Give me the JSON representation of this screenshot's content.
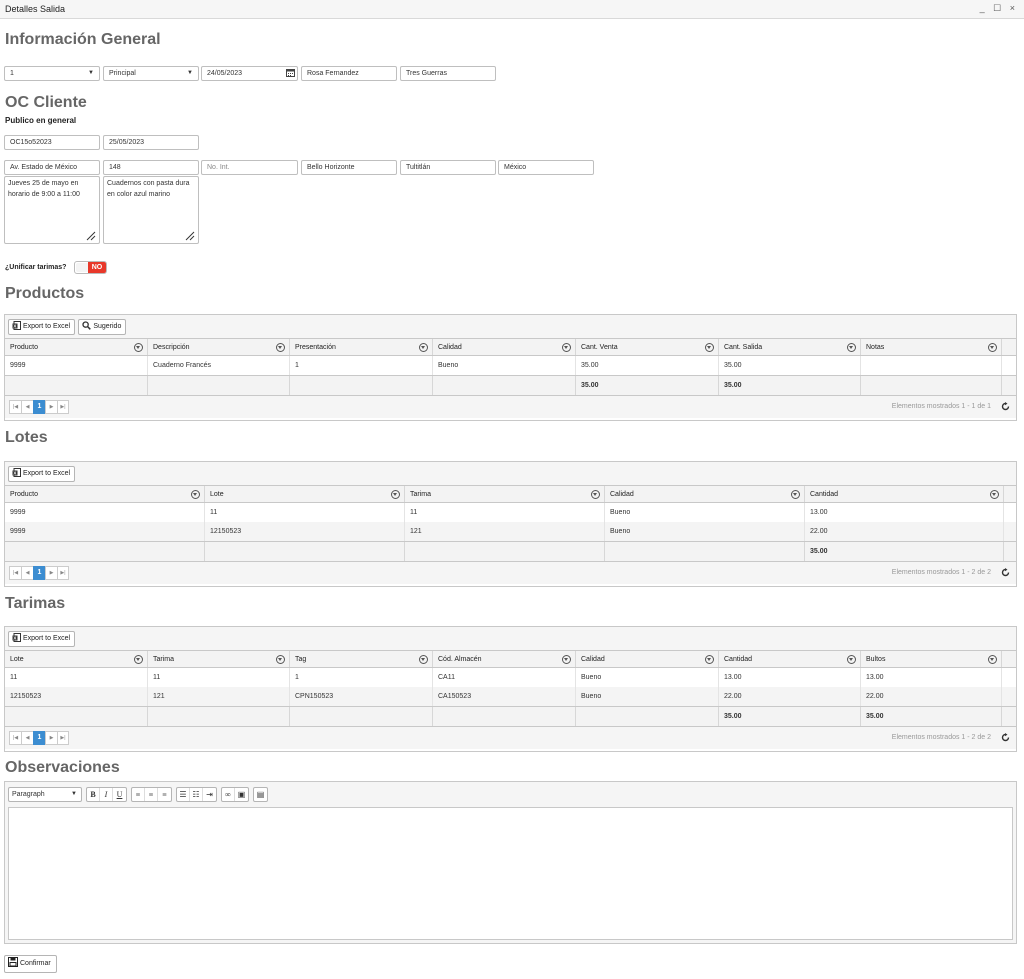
{
  "window": {
    "title": "Detalles Salida",
    "minimize": "_",
    "maximize": "☐",
    "close": "×"
  },
  "general": {
    "heading": "Información General",
    "field1": "1",
    "field2": "Principal",
    "date": "24/05/2023",
    "contact": "Rosa Fernandez",
    "carrier": "Tres Guerras"
  },
  "oc": {
    "heading": "OC Cliente",
    "customer": "Publico en general",
    "order": "OC15o52023",
    "order_date": "25/05/2023",
    "street": "Av. Estado de México",
    "ext_num": "148",
    "int_num_placeholder": "No. Int.",
    "colony": "Bello Horizonte",
    "city": "Tultitlán",
    "state": "México",
    "note1": "Jueves 25 de mayo en horario de 9:00  a 11:00",
    "note2": "Cuadernos con pasta dura en color azul marino"
  },
  "unify": {
    "label": "¿Unificar tarimas?",
    "state": "NO"
  },
  "productos": {
    "heading": "Productos",
    "export": "Export to Excel",
    "suggested": "Sugerido",
    "columns": [
      "Producto",
      "Descripción",
      "Presentación",
      "Calidad",
      "Cant. Venta",
      "Cant. Salida",
      "Notas"
    ],
    "rows": [
      [
        "9999",
        "Cuaderno Francés",
        "1",
        "Bueno",
        "35.00",
        "35.00",
        ""
      ]
    ],
    "totals": [
      "",
      "",
      "",
      "",
      "35.00",
      "35.00",
      ""
    ],
    "page": "1",
    "info": "Elementos mostrados 1 - 1 de 1"
  },
  "lotes": {
    "heading": "Lotes",
    "export": "Export to Excel",
    "columns": [
      "Producto",
      "Lote",
      "Tarima",
      "Calidad",
      "Cantidad"
    ],
    "rows": [
      [
        "9999",
        "11",
        "11",
        "Bueno",
        "13.00"
      ],
      [
        "9999",
        "12150523",
        "121",
        "Bueno",
        "22.00"
      ]
    ],
    "totals": [
      "",
      "",
      "",
      "",
      "35.00"
    ],
    "page": "1",
    "info": "Elementos mostrados 1 - 2 de 2"
  },
  "tarimas": {
    "heading": "Tarimas",
    "export": "Export to Excel",
    "columns": [
      "Lote",
      "Tarima",
      "Tag",
      "Cód. Almacén",
      "Calidad",
      "Cantidad",
      "Bultos"
    ],
    "rows": [
      [
        "11",
        "11",
        "1",
        "CA11",
        "Bueno",
        "13.00",
        "13.00"
      ],
      [
        "12150523",
        "121",
        "CPN150523",
        "CA150523",
        "Bueno",
        "22.00",
        "22.00"
      ]
    ],
    "totals": [
      "",
      "",
      "",
      "",
      "",
      "35.00",
      "35.00"
    ],
    "page": "1",
    "info": "Elementos mostrados 1 - 2 de 2"
  },
  "observaciones": {
    "heading": "Observaciones",
    "format": "Paragraph"
  },
  "confirm": "Confirmar",
  "colors": {
    "accent": "#3c8dd1",
    "toggle_off": "#e8382a",
    "heading": "#666666"
  }
}
